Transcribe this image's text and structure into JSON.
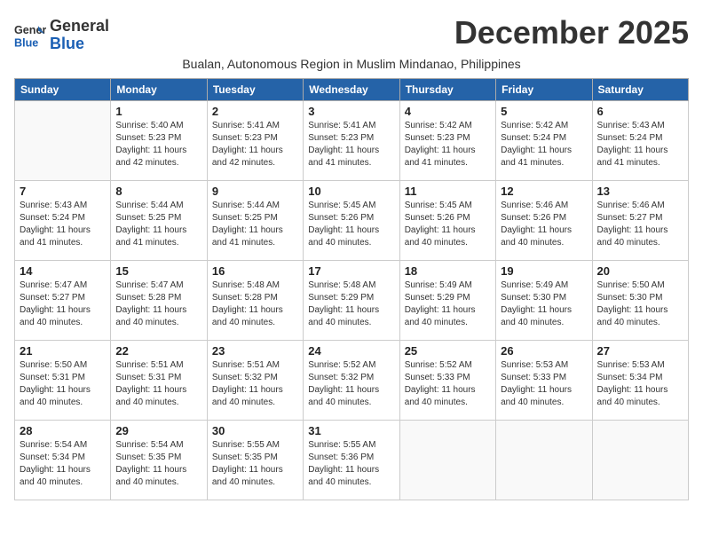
{
  "header": {
    "logo_line1": "General",
    "logo_line2": "Blue",
    "month_year": "December 2025",
    "subtitle": "Bualan, Autonomous Region in Muslim Mindanao, Philippines"
  },
  "days_of_week": [
    "Sunday",
    "Monday",
    "Tuesday",
    "Wednesday",
    "Thursday",
    "Friday",
    "Saturday"
  ],
  "weeks": [
    [
      {
        "day": "",
        "info": ""
      },
      {
        "day": "1",
        "info": "Sunrise: 5:40 AM\nSunset: 5:23 PM\nDaylight: 11 hours\nand 42 minutes."
      },
      {
        "day": "2",
        "info": "Sunrise: 5:41 AM\nSunset: 5:23 PM\nDaylight: 11 hours\nand 42 minutes."
      },
      {
        "day": "3",
        "info": "Sunrise: 5:41 AM\nSunset: 5:23 PM\nDaylight: 11 hours\nand 41 minutes."
      },
      {
        "day": "4",
        "info": "Sunrise: 5:42 AM\nSunset: 5:23 PM\nDaylight: 11 hours\nand 41 minutes."
      },
      {
        "day": "5",
        "info": "Sunrise: 5:42 AM\nSunset: 5:24 PM\nDaylight: 11 hours\nand 41 minutes."
      },
      {
        "day": "6",
        "info": "Sunrise: 5:43 AM\nSunset: 5:24 PM\nDaylight: 11 hours\nand 41 minutes."
      }
    ],
    [
      {
        "day": "7",
        "info": "Sunrise: 5:43 AM\nSunset: 5:24 PM\nDaylight: 11 hours\nand 41 minutes."
      },
      {
        "day": "8",
        "info": "Sunrise: 5:44 AM\nSunset: 5:25 PM\nDaylight: 11 hours\nand 41 minutes."
      },
      {
        "day": "9",
        "info": "Sunrise: 5:44 AM\nSunset: 5:25 PM\nDaylight: 11 hours\nand 41 minutes."
      },
      {
        "day": "10",
        "info": "Sunrise: 5:45 AM\nSunset: 5:26 PM\nDaylight: 11 hours\nand 40 minutes."
      },
      {
        "day": "11",
        "info": "Sunrise: 5:45 AM\nSunset: 5:26 PM\nDaylight: 11 hours\nand 40 minutes."
      },
      {
        "day": "12",
        "info": "Sunrise: 5:46 AM\nSunset: 5:26 PM\nDaylight: 11 hours\nand 40 minutes."
      },
      {
        "day": "13",
        "info": "Sunrise: 5:46 AM\nSunset: 5:27 PM\nDaylight: 11 hours\nand 40 minutes."
      }
    ],
    [
      {
        "day": "14",
        "info": "Sunrise: 5:47 AM\nSunset: 5:27 PM\nDaylight: 11 hours\nand 40 minutes."
      },
      {
        "day": "15",
        "info": "Sunrise: 5:47 AM\nSunset: 5:28 PM\nDaylight: 11 hours\nand 40 minutes."
      },
      {
        "day": "16",
        "info": "Sunrise: 5:48 AM\nSunset: 5:28 PM\nDaylight: 11 hours\nand 40 minutes."
      },
      {
        "day": "17",
        "info": "Sunrise: 5:48 AM\nSunset: 5:29 PM\nDaylight: 11 hours\nand 40 minutes."
      },
      {
        "day": "18",
        "info": "Sunrise: 5:49 AM\nSunset: 5:29 PM\nDaylight: 11 hours\nand 40 minutes."
      },
      {
        "day": "19",
        "info": "Sunrise: 5:49 AM\nSunset: 5:30 PM\nDaylight: 11 hours\nand 40 minutes."
      },
      {
        "day": "20",
        "info": "Sunrise: 5:50 AM\nSunset: 5:30 PM\nDaylight: 11 hours\nand 40 minutes."
      }
    ],
    [
      {
        "day": "21",
        "info": "Sunrise: 5:50 AM\nSunset: 5:31 PM\nDaylight: 11 hours\nand 40 minutes."
      },
      {
        "day": "22",
        "info": "Sunrise: 5:51 AM\nSunset: 5:31 PM\nDaylight: 11 hours\nand 40 minutes."
      },
      {
        "day": "23",
        "info": "Sunrise: 5:51 AM\nSunset: 5:32 PM\nDaylight: 11 hours\nand 40 minutes."
      },
      {
        "day": "24",
        "info": "Sunrise: 5:52 AM\nSunset: 5:32 PM\nDaylight: 11 hours\nand 40 minutes."
      },
      {
        "day": "25",
        "info": "Sunrise: 5:52 AM\nSunset: 5:33 PM\nDaylight: 11 hours\nand 40 minutes."
      },
      {
        "day": "26",
        "info": "Sunrise: 5:53 AM\nSunset: 5:33 PM\nDaylight: 11 hours\nand 40 minutes."
      },
      {
        "day": "27",
        "info": "Sunrise: 5:53 AM\nSunset: 5:34 PM\nDaylight: 11 hours\nand 40 minutes."
      }
    ],
    [
      {
        "day": "28",
        "info": "Sunrise: 5:54 AM\nSunset: 5:34 PM\nDaylight: 11 hours\nand 40 minutes."
      },
      {
        "day": "29",
        "info": "Sunrise: 5:54 AM\nSunset: 5:35 PM\nDaylight: 11 hours\nand 40 minutes."
      },
      {
        "day": "30",
        "info": "Sunrise: 5:55 AM\nSunset: 5:35 PM\nDaylight: 11 hours\nand 40 minutes."
      },
      {
        "day": "31",
        "info": "Sunrise: 5:55 AM\nSunset: 5:36 PM\nDaylight: 11 hours\nand 40 minutes."
      },
      {
        "day": "",
        "info": ""
      },
      {
        "day": "",
        "info": ""
      },
      {
        "day": "",
        "info": ""
      }
    ]
  ]
}
